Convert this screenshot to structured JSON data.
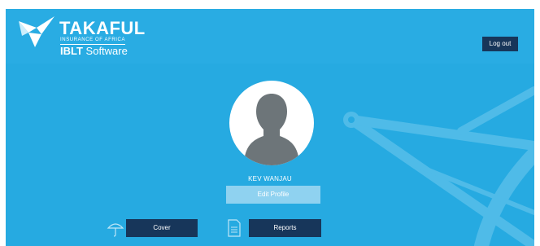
{
  "brand": {
    "name": "TAKAFUL",
    "tagline": "INSURANCE OF AFRICA",
    "product_bold": "IBLT",
    "product_rest": "Software"
  },
  "header": {
    "logout_label": "Log out"
  },
  "profile": {
    "user_name": "KEV WANJAU",
    "edit_label": "Edit Profile"
  },
  "nav": {
    "cover": {
      "label": "Cover",
      "icon": "umbrella-icon"
    },
    "reports": {
      "label": "Reports",
      "icon": "document-icon"
    }
  },
  "colors": {
    "background": "#26aae1",
    "dark_button": "#17365a",
    "light_button": "#8fd2f0",
    "avatar_silhouette": "#6d7579"
  }
}
